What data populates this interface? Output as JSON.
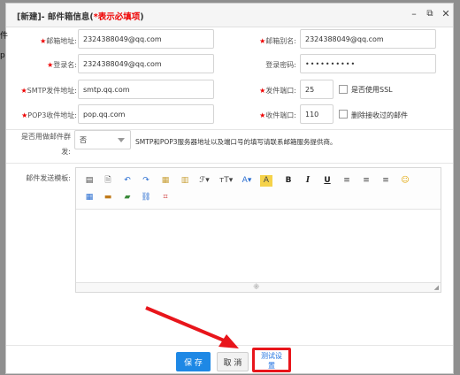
{
  "dialog": {
    "title_prefix": "[新建]- 邮件箱信息(",
    "title_required": "*表示必填项",
    "title_suffix": ")",
    "controls": {
      "minimize": "–",
      "maximize": "⧉",
      "close": "✕"
    }
  },
  "background_fragments": [
    "件",
    "p"
  ],
  "form": {
    "mail_address": {
      "label": "邮箱地址:",
      "value": "2324388049@qq.com",
      "required": true
    },
    "mail_alias": {
      "label": "邮箱别名:",
      "value": "2324388049@qq.com",
      "required": true
    },
    "login_name": {
      "label": "登录名:",
      "value": "2324388049@qq.com",
      "required": true
    },
    "login_password": {
      "label": "登录密码:",
      "value": "••••••••••",
      "required": false
    },
    "smtp_address": {
      "label": "SMTP发件地址:",
      "value": "smtp.qq.com",
      "required": true
    },
    "send_port": {
      "label": "发件端口:",
      "value": "25",
      "required": true
    },
    "use_ssl": {
      "label": "是否使用SSL",
      "checked": false
    },
    "pop3_address": {
      "label": "POP3收件地址:",
      "value": "pop.qq.com",
      "required": true
    },
    "receive_port": {
      "label": "收件端口:",
      "value": "110",
      "required": true
    },
    "delete_received": {
      "label": "删除接收过的邮件",
      "checked": false
    },
    "group_send": {
      "label_line1": "是否用做邮件群",
      "label_line2": "发:",
      "value": "否"
    },
    "group_hint": "SMTP和POP3服务器地址以及端口号的填写请联系邮箱服务提供商。",
    "template": {
      "label": "邮件发送模板:"
    }
  },
  "buttons": {
    "save": "保 存",
    "cancel": "取 消",
    "test": "测试设置"
  },
  "colors": {
    "primary": "#1e88e5",
    "required_star": "#ee0000",
    "highlight": "#e8151b"
  }
}
